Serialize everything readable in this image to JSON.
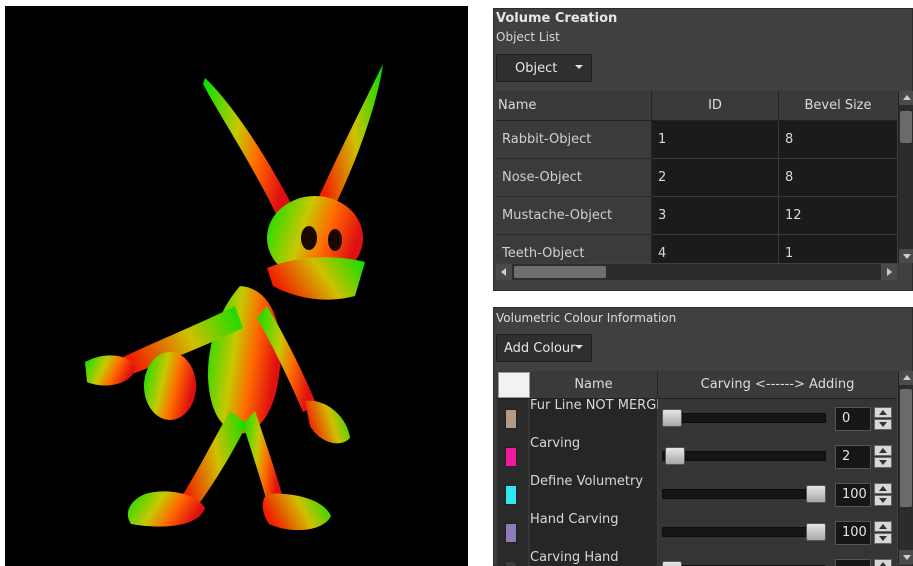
{
  "viewport": {
    "description_icon": "rabbit-3d-render"
  },
  "volume_panel": {
    "title": "Volume Creation",
    "subtitle": "Object List",
    "dropdown_label": "Object",
    "columns": [
      "Name",
      "ID",
      "Bevel Size"
    ],
    "rows": [
      {
        "name": "Rabbit-Object",
        "id": "1",
        "bevel": "8"
      },
      {
        "name": "Nose-Object",
        "id": "2",
        "bevel": "8"
      },
      {
        "name": "Mustache-Object",
        "id": "3",
        "bevel": "12"
      },
      {
        "name": "Teeth-Object",
        "id": "4",
        "bevel": "1"
      }
    ]
  },
  "colour_panel": {
    "title": "Volumetric Colour Information",
    "add_button": "Add Colour",
    "columns": {
      "name": "Name",
      "carving": "Carving <------> Adding"
    },
    "rows": [
      {
        "name": "Fur Line NOT MERGED",
        "value": "0",
        "level": 0,
        "color": "#b39a86"
      },
      {
        "name": "Carving",
        "value": "2",
        "level": 0.02,
        "color": "#ee1aa0"
      },
      {
        "name": "Define Volumetry",
        "value": "100",
        "level": 1,
        "color": "#2ee8f2"
      },
      {
        "name": "Hand Carving",
        "value": "100",
        "level": 1,
        "color": "#8e7cb8"
      },
      {
        "name": "Carving Hand",
        "value": "",
        "level": 0,
        "color": "#3c3c3c"
      }
    ]
  }
}
